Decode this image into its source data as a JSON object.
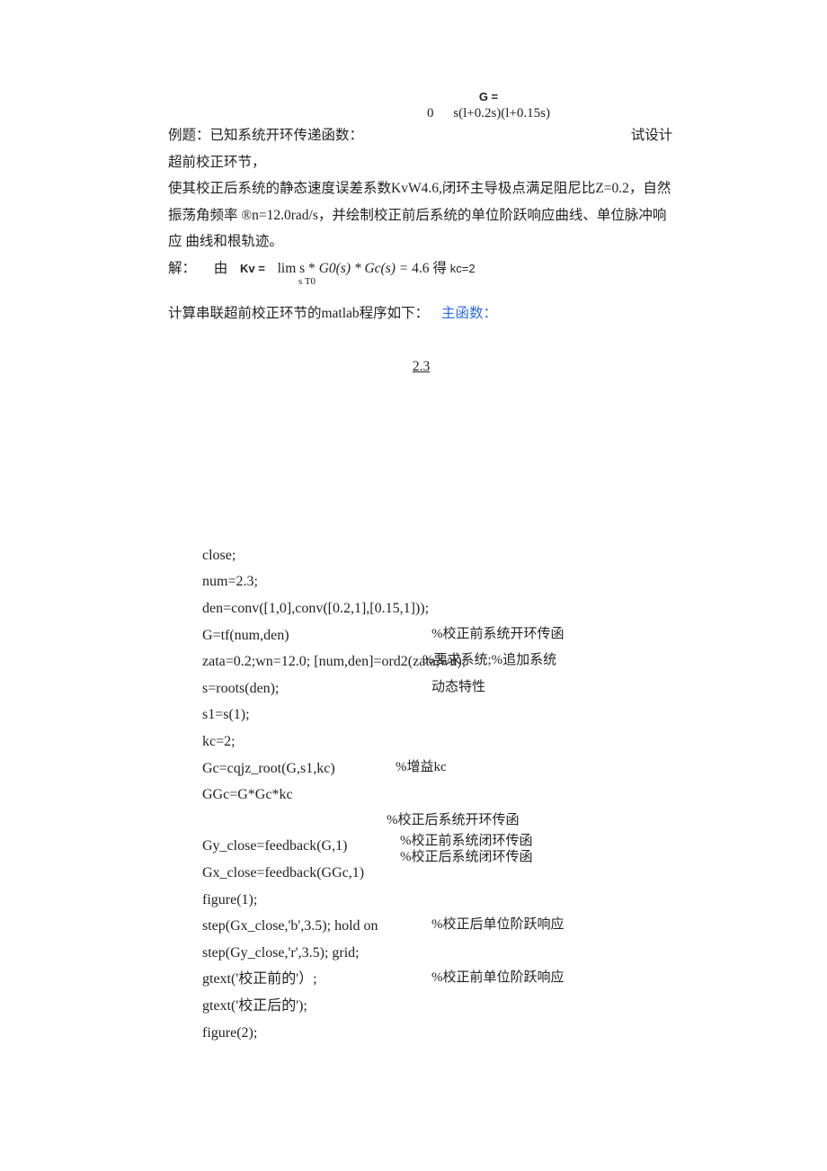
{
  "formula": {
    "top": "G =",
    "left": "0",
    "right": "s(l+0.2s)(l+0.15s)"
  },
  "p1a": "例题：已知系统开环传递函数：",
  "p1b": "试设计超前校正环节，",
  "p2": "使其校正后系统的静态速度误差系数KvW4.6,闭环主导极点满足阻尼比Z=0.2，自然 振荡角频率 ®n=12.0rad/s，并绘制校正前后系统的单位阶跃响应曲线、单位脉冲响应 曲线和根轨迹。",
  "p3a": "解：",
  "p3b": "由",
  "p3c": "Kv =",
  "p3d": "lim s *",
  "p3e": " G0(s) * Gc(s)",
  "p3f": "=",
  "p3g": " 4.6 得",
  "p3h": " kc=2",
  "p3sub": "s T0",
  "p4a": "计算串联超前校正环节的matlab程序如下：",
  "p4b": "主函数：",
  "num": "2.3",
  "code": {
    "l1": "close;",
    "l2": "num=2.3;",
    "l3": "den=conv([1,0],conv([0.2,1],[0.15,1]));",
    "l4a": "G=tf(num,den)",
    "l4b": "%校正前系统开环传函",
    "l5a": "zata=0.2;wn=12.0; [num,den]=ord2(zata,wn);",
    "l5b": "%要求系统;%追加系统",
    "l6a": "s=roots(den);",
    "l6b": "动态特性",
    "l7": "s1=s(1);",
    "l8": "kc=2;",
    "l9a": "Gc=cqjz_root(G,s1,kc)",
    "l9b": "%增益kc",
    "l10": "GGc=G*Gc*kc",
    "l11a": "",
    "l11b": "%校正后系统开环传函",
    "l12a": "Gy_close=feedback(G,1)",
    "l12b": "%校正前系统闭环传函",
    "l12c": "%校正后系统闭环传函",
    "l13a": "Gx_close=feedback(GGc,1)",
    "l14": "figure(1);",
    "l15a": "step(Gx_close,'b',3.5); hold on",
    "l15b": "%校正后单位阶跃响应",
    "l16": "step(Gy_close,'r',3.5); grid;",
    "l17a": "gtext('校正前的'）;",
    "l17b": "%校正前单位阶跃响应",
    "l18": "gtext('校正后的');",
    "l19": "figure(2);"
  }
}
